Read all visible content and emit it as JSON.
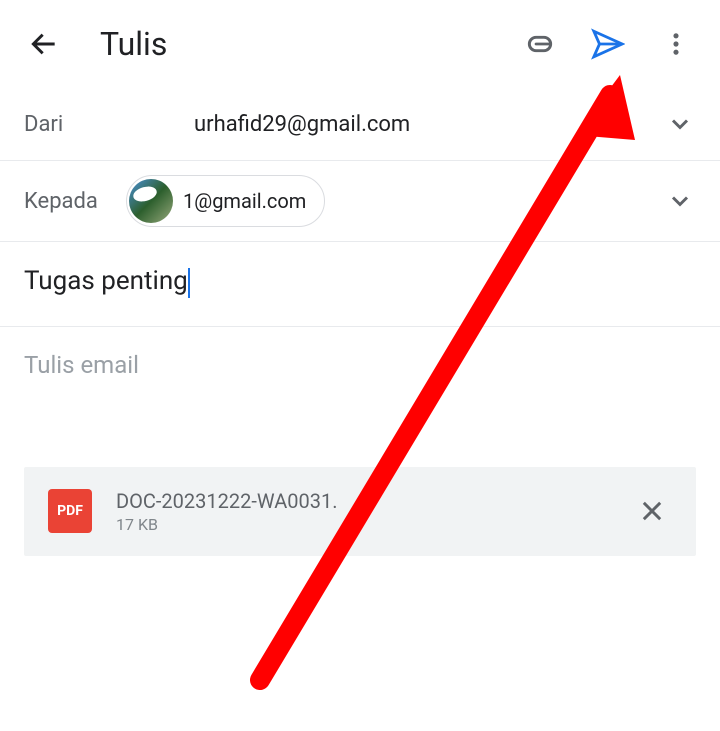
{
  "header": {
    "title": "Tulis"
  },
  "from": {
    "label": "Dari",
    "email": "urhafid29@gmail.com"
  },
  "to": {
    "label": "Kepada",
    "recipient_email": "1@gmail.com"
  },
  "subject": {
    "value": "Tugas penting"
  },
  "body": {
    "placeholder": "Tulis email"
  },
  "attachment": {
    "badge": "PDF",
    "filename": "DOC-20231222-WA0031.",
    "size": "17 KB"
  },
  "annotation": {
    "arrow_color": "#ff0000"
  }
}
